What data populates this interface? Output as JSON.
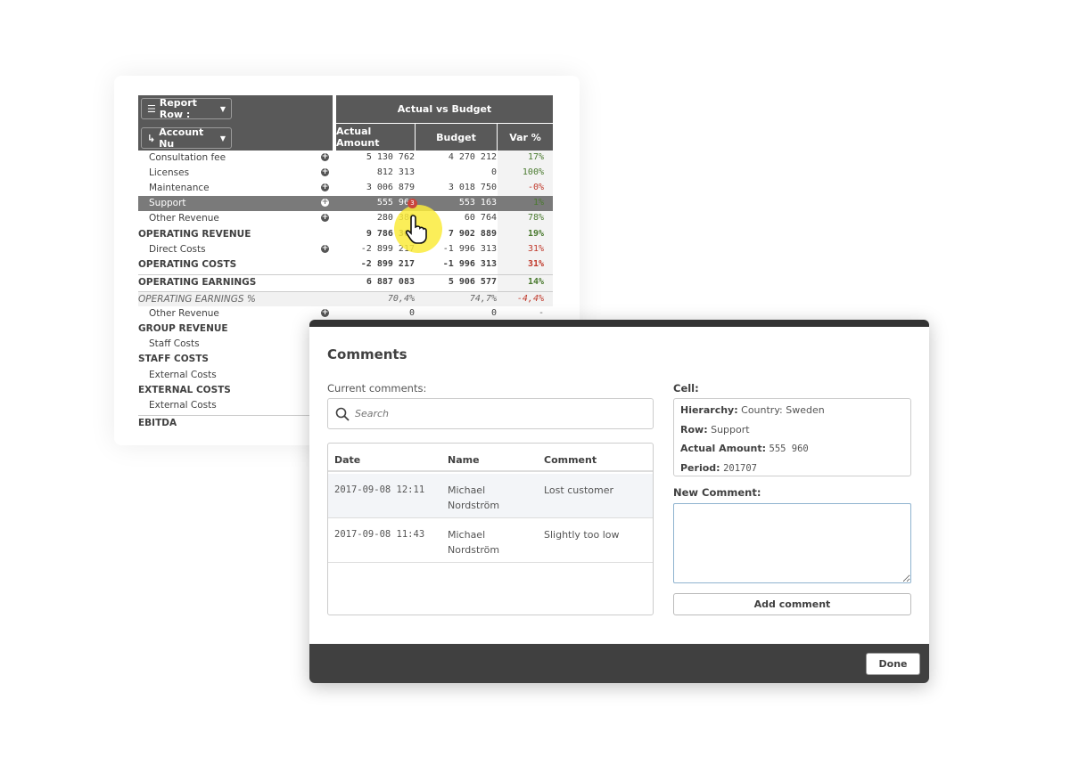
{
  "table": {
    "dimension_1": "Report Row :",
    "dimension_2": "Account Nu",
    "group_header": "Actual vs Budget",
    "columns": [
      "Actual Amount",
      "Budget",
      "Var %"
    ],
    "colors": {
      "positive": "#4a7a2f",
      "negative": "#c0392b",
      "header": "#595959",
      "selected_row": "#7a7a7a"
    },
    "comment_badge": "3",
    "rows": [
      {
        "label": "Consultation fee",
        "type": "sub",
        "expand": true,
        "actual": "5 130 762",
        "budget": "4 270 212",
        "var": "17%",
        "var_tone": "positive"
      },
      {
        "label": "Licenses",
        "type": "sub",
        "expand": true,
        "actual": "812 313",
        "budget": "0",
        "var": "100%",
        "var_tone": "positive"
      },
      {
        "label": "Maintenance",
        "type": "sub",
        "expand": true,
        "actual": "3 006 879",
        "budget": "3 018 750",
        "var": "-0%",
        "var_tone": "negative"
      },
      {
        "label": "Support",
        "type": "sub",
        "expand": true,
        "selected": true,
        "actual": "555 960",
        "budget": "553 163",
        "var": "1%",
        "var_tone": "positive"
      },
      {
        "label": "Other Revenue",
        "type": "sub",
        "expand": true,
        "actual": "280 386",
        "budget": "60 764",
        "var": "78%",
        "var_tone": "positive"
      },
      {
        "label": "OPERATING REVENUE",
        "type": "total",
        "actual": "9 786 300",
        "budget": "7 902 889",
        "var": "19%",
        "var_tone": "positive"
      },
      {
        "label": "Direct Costs",
        "type": "sub",
        "expand": true,
        "actual": "-2 899 217",
        "budget": "-1 996 313",
        "var": "31%",
        "var_tone": "negative"
      },
      {
        "label": "OPERATING COSTS",
        "type": "total",
        "actual": "-2 899 217",
        "budget": "-1 996 313",
        "var": "31%",
        "var_tone": "negative"
      },
      {
        "label": "OPERATING EARNINGS",
        "type": "total",
        "actual": "6 887 083",
        "budget": "5 906 577",
        "var": "14%",
        "var_tone": "positive"
      },
      {
        "label": "OPERATING EARNINGS %",
        "type": "italic",
        "actual": "70,4%",
        "budget": "74,7%",
        "var": "-4,4%",
        "var_tone": "negative"
      },
      {
        "label": "Other Revenue",
        "type": "sub",
        "expand": true,
        "actual": "0",
        "budget": "0",
        "var": "-",
        "var_tone": "neutral"
      },
      {
        "label": "GROUP REVENUE",
        "type": "total"
      },
      {
        "label": "Staff Costs",
        "type": "sub"
      },
      {
        "label": "STAFF COSTS",
        "type": "total"
      },
      {
        "label": "External Costs",
        "type": "sub"
      },
      {
        "label": "EXTERNAL COSTS",
        "type": "total"
      },
      {
        "label": "External Costs",
        "type": "sub"
      },
      {
        "label": "EBITDA",
        "type": "total"
      }
    ]
  },
  "dialog": {
    "title": "Comments",
    "current_label": "Current comments:",
    "search_placeholder": "Search",
    "headers": [
      "Date",
      "Name",
      "Comment"
    ],
    "comments": [
      {
        "date": "2017-09-08 12:11",
        "name": "Michael Nordström",
        "comment": "Lost customer"
      },
      {
        "date": "2017-09-08 11:43",
        "name": "Michael Nordström",
        "comment": "Slightly too low"
      }
    ],
    "cell_label": "Cell:",
    "cell": {
      "hierarchy_key": "Hierarchy:",
      "hierarchy": "Country: Sweden",
      "row_key": "Row:",
      "row": "Support",
      "amount_key": "Actual Amount:",
      "amount": "555 960",
      "period_key": "Period:",
      "period": "201707"
    },
    "new_comment_label": "New Comment:",
    "new_comment_value": "",
    "add_button": "Add comment",
    "done_button": "Done"
  }
}
